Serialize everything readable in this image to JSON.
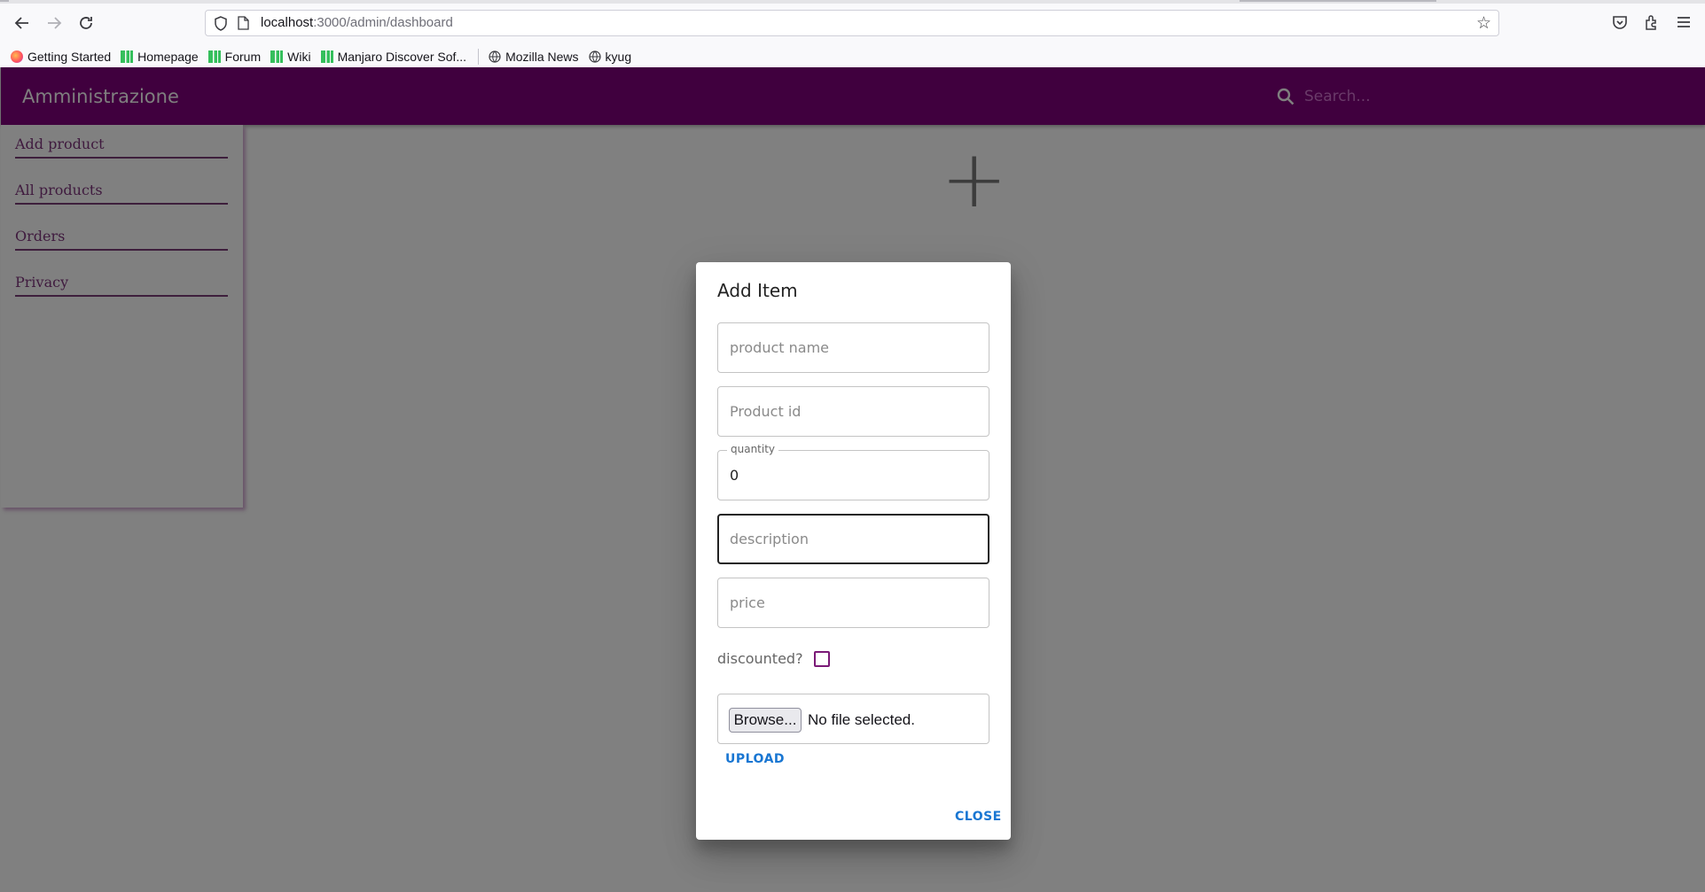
{
  "browser": {
    "url_host": "localhost",
    "url_path": ":3000/admin/dashboard",
    "bookmarks": [
      "Getting Started",
      "Homepage",
      "Forum",
      "Wiki",
      "Manjaro Discover Sof...",
      "Mozilla News",
      "kyug"
    ]
  },
  "app": {
    "title": "Amministrazione",
    "search_placeholder": "Search...",
    "accent_color": "#40003e"
  },
  "sidebar": {
    "items": [
      "Add product",
      "All products",
      "Orders",
      "Privacy"
    ]
  },
  "dialog": {
    "title": "Add Item",
    "fields": {
      "product_name_placeholder": "product name",
      "product_id_placeholder": "Product id",
      "quantity_label": "quantity",
      "quantity_value": "0",
      "description_placeholder": "description",
      "price_placeholder": "price"
    },
    "discounted_label": "discounted?",
    "browse_label": "Browse...",
    "file_status": "No file selected.",
    "upload_label": "UPLOAD",
    "close_label": "CLOSE"
  }
}
